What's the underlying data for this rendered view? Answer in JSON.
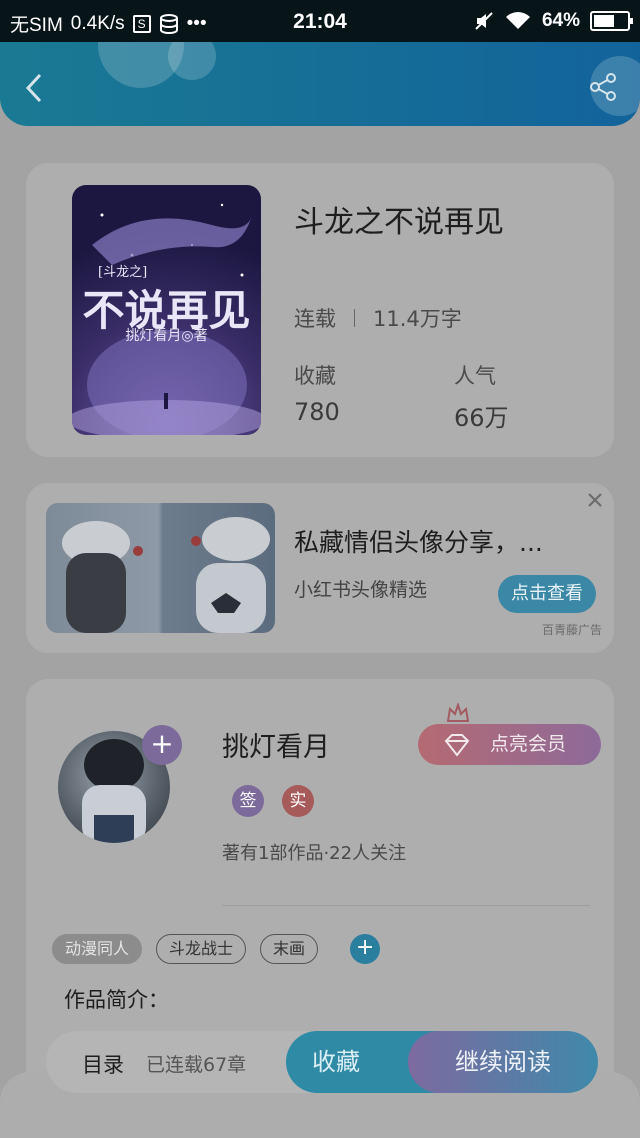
{
  "status_bar": {
    "carrier": "无SIM",
    "speed": "0.4K/s",
    "s_icon_label": "S",
    "more": "•••",
    "time": "21:04",
    "battery": "64%",
    "battery_level": 0.64
  },
  "book": {
    "title": "斗龙之不说再见",
    "status": "连载",
    "word_count": "11.4万字",
    "stats": [
      {
        "label": "收藏",
        "value": "780"
      },
      {
        "label": "人气",
        "value": "66万"
      }
    ],
    "cover": {
      "series": "[斗龙之]",
      "title": "不说再见",
      "author_line": "挑灯看月◎著"
    }
  },
  "ad": {
    "title": "私藏情侣头像分享，...",
    "subtitle": "小红书头像精选",
    "button": "点击查看",
    "source": "百青藤广告",
    "close": "✕"
  },
  "author": {
    "name": "挑灯看月",
    "vip_button": "点亮会员",
    "badges": [
      {
        "text": "签",
        "color": "#7b6a9a"
      },
      {
        "text": "实",
        "color": "#a65a5a"
      }
    ],
    "info": "著有1部作品·22人关注",
    "plus": "+"
  },
  "tags": [
    "动漫同人",
    "斗龙战士",
    "末画"
  ],
  "tag_add": "+",
  "intro": {
    "title": "作品简介："
  },
  "bottom_bar": {
    "toc_label": "目录",
    "toc_count": "已连载67章",
    "favorite_button": "收藏",
    "read_button": "继续阅读"
  },
  "colors": {
    "header_accent": "#1a7a93",
    "button_blue": "#2f8aa6",
    "vip_gradient_start": "#b56a72",
    "read_gradient_start": "#7d6aa0"
  },
  "icons": [
    "back-icon",
    "share-icon",
    "close-icon",
    "crown-icon",
    "diamond-icon",
    "plus-icon",
    "wifi-icon",
    "mute-icon"
  ]
}
